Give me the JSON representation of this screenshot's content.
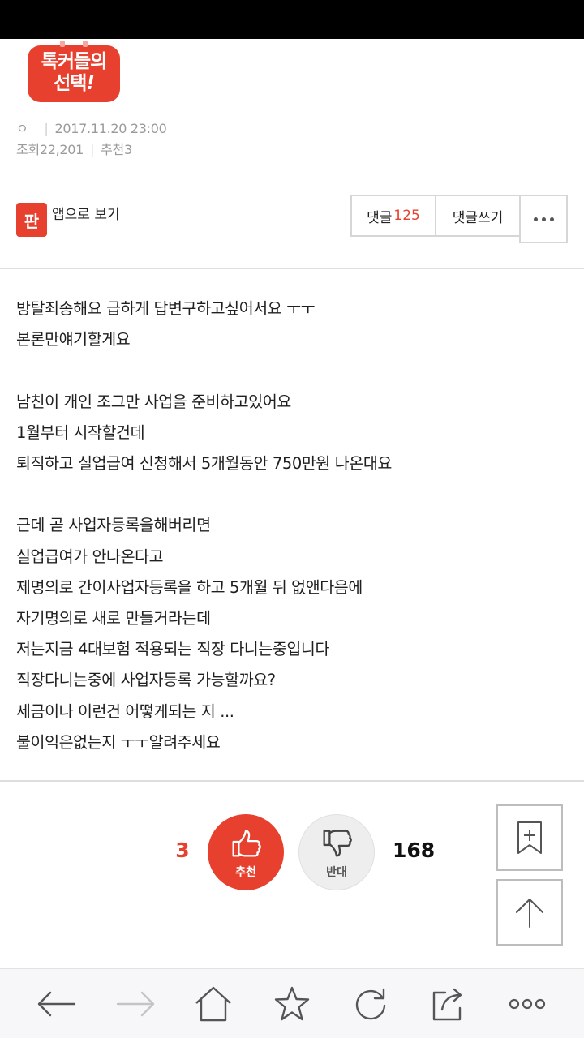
{
  "badge": {
    "line1": "톡커들의",
    "line2_main": "선택",
    "line2_mark": "!"
  },
  "meta": {
    "author": "ㅇ",
    "date": "2017.11.20 23:00",
    "views": "조회22,201",
    "recommends": "추천3"
  },
  "app_view": {
    "logo_text": "판",
    "label": "앱으로 보기"
  },
  "actions": {
    "comment_label": "댓글",
    "comment_count": "125",
    "write_comment_label": "댓글쓰기"
  },
  "body_text": "방탈죄송해요 급하게 답변구하고싶어서요 ㅜㅜ\n본론만얘기할게요\n\n남친이 개인 조그만 사업을 준비하고있어요\n1월부터 시작할건데\n퇴직하고 실업급여 신청해서 5개월동안 750만원 나온대요\n\n근데 곧 사업자등록을해버리면\n실업급여가 안나온다고\n제명의로 간이사업자등록을 하고 5개월 뒤 없앤다음에\n자기명의로 새로 만들거라는데\n저는지금 4대보험 적용되는 직장 다니는중입니다\n직장다니는중에 사업자등록 가능할까요?\n세금이나 이런건 어떻게되는 지 ...\n불이익은없는지 ㅜㅜ알려주세요",
  "vote": {
    "up_count": "3",
    "up_label": "추천",
    "down_label": "반대",
    "down_count": "168"
  },
  "icons": {
    "side": [
      "bookmark-add-icon",
      "scroll-top-arrow-icon"
    ],
    "nav": [
      "back-arrow-icon",
      "forward-arrow-icon",
      "home-icon",
      "star-icon",
      "refresh-icon",
      "share-icon",
      "more-dots-icon"
    ]
  },
  "colors": {
    "accent": "#e8402e",
    "muted": "#9a9a9a"
  }
}
